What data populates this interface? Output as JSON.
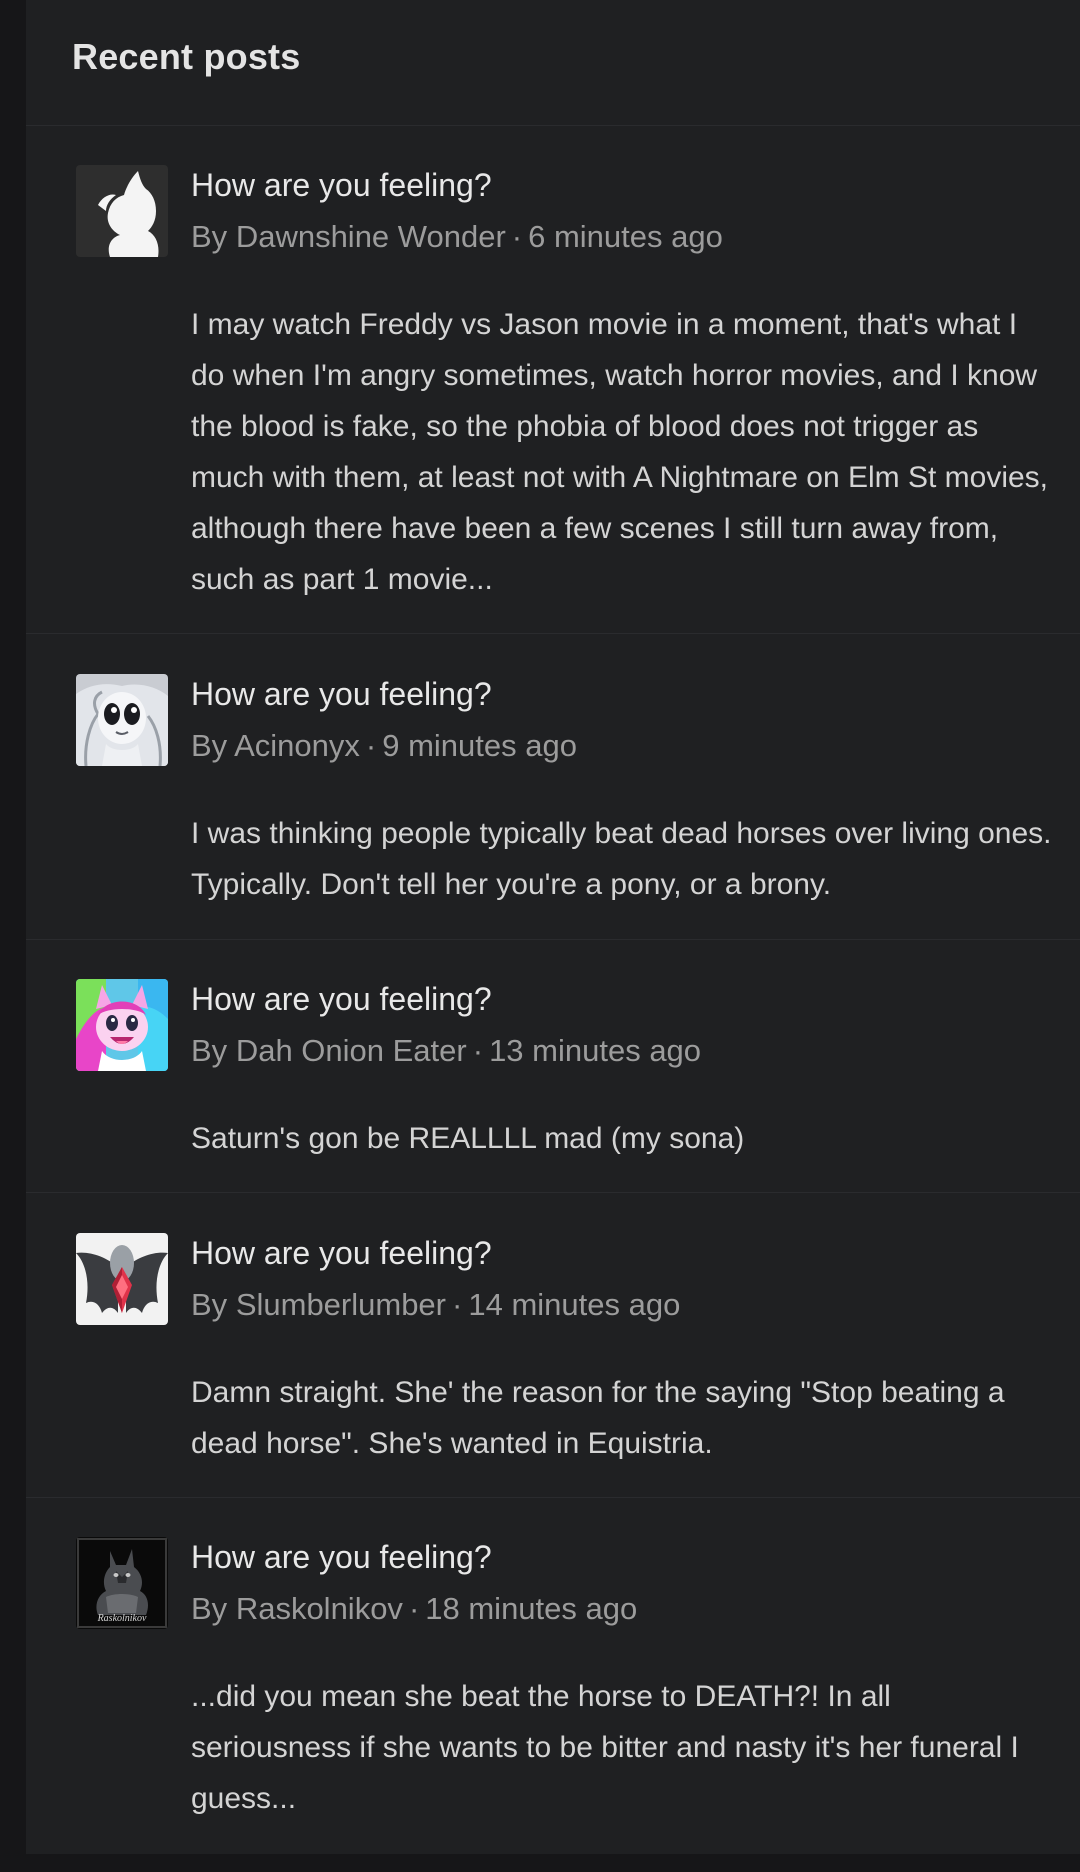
{
  "section": {
    "title": "Recent posts"
  },
  "posts": [
    {
      "title": "How are you feeling?",
      "by": "By",
      "author": "Dawnshine Wonder",
      "time": "6 minutes ago",
      "excerpt": "I may watch Freddy vs Jason movie in a moment, that's what I do when I'm angry sometimes, watch horror movies, and I know the blood is fake, so the phobia of blood does not trigger as much with them, at least not with A Nightmare on Elm St movies, although there have been a few scenes I still turn away from, such as part 1 movie..."
    },
    {
      "title": "How are you feeling?",
      "by": "By",
      "author": "Acinonyx",
      "time": "9 minutes ago",
      "excerpt": "I was thinking people typically beat dead horses over living ones. Typically. Don't tell her you're a pony, or a brony."
    },
    {
      "title": "How are you feeling?",
      "by": "By",
      "author": "Dah Onion Eater",
      "time": "13 minutes ago",
      "excerpt": "Saturn's gon be REALLLL mad (my sona)"
    },
    {
      "title": "How are you feeling?",
      "by": "By",
      "author": "Slumberlumber",
      "time": "14 minutes ago",
      "excerpt": "Damn straight. She' the reason for the saying \"Stop beating a dead horse\". She's wanted in Equistria."
    },
    {
      "title": "How are you feeling?",
      "by": "By",
      "author": "Raskolnikov",
      "time": "18 minutes ago",
      "excerpt": "...did you mean she beat the horse to DEATH?! In all seriousness if she wants to be bitter and nasty it's her funeral I guess...",
      "avatar_text": "Raskolnikov"
    }
  ],
  "colors": {
    "background": "#161618",
    "panel": "#1f2022",
    "divider": "#2a2b2e",
    "title_text": "#e8e8e8",
    "meta_text": "#9c9c9c",
    "body_text": "#d4d4d4"
  },
  "icons": [
    "pony-silhouette-avatar",
    "white-pony-avatar",
    "rainbow-pony-avatar",
    "bat-wing-avatar",
    "dark-wolf-avatar"
  ]
}
